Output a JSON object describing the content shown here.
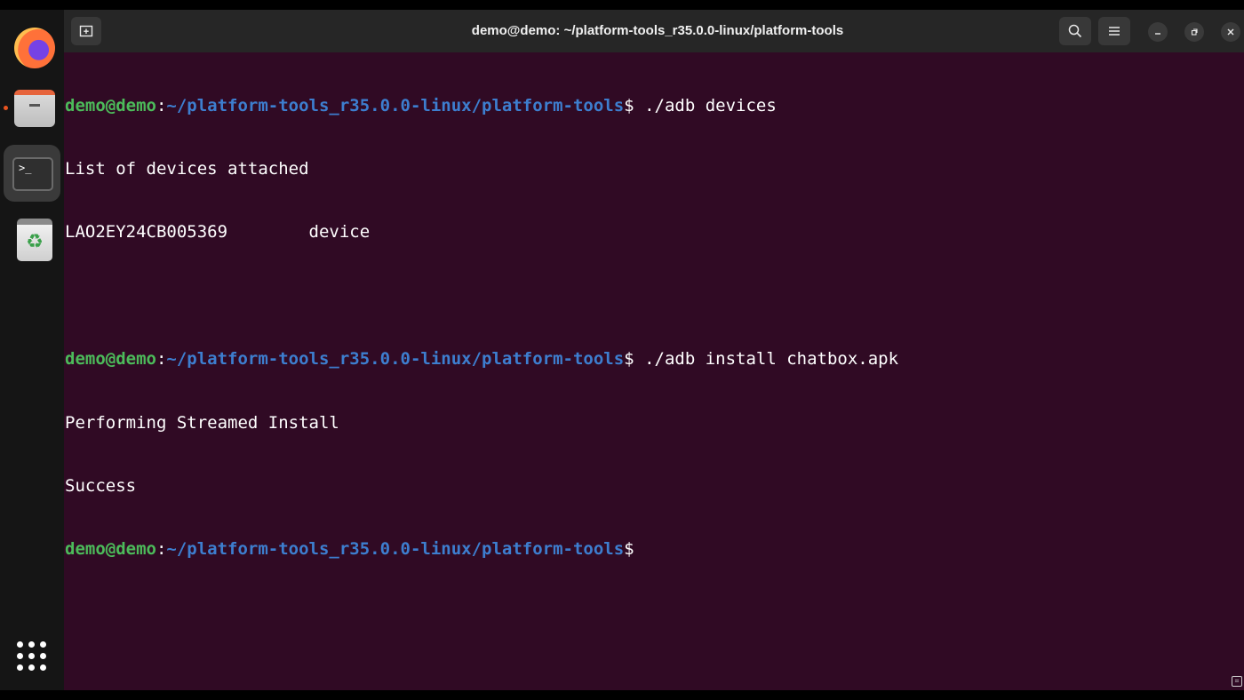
{
  "window": {
    "title": "demo@demo: ~/platform-tools_r35.0.0-linux/platform-tools",
    "new_tab_icon": "new-tab-icon",
    "controls": [
      "search-icon",
      "menu-icon",
      "minimize-icon",
      "restore-icon",
      "close-icon"
    ]
  },
  "dock": {
    "items": [
      "firefox-icon",
      "files-icon",
      "terminal-icon",
      "trash-icon"
    ],
    "show_apps_icon": "apps-grid-icon"
  },
  "terminal": {
    "user_host": "demo@demo",
    "path": "~/platform-tools_r35.0.0-linux/platform-tools",
    "prompt_symbol": "$",
    "lines": [
      {
        "type": "prompt",
        "command": " ./adb devices"
      },
      {
        "type": "output",
        "text": "List of devices attached"
      },
      {
        "type": "output",
        "text": "LAO2EY24CB005369\tdevice"
      },
      {
        "type": "output",
        "text": ""
      },
      {
        "type": "prompt",
        "command": " ./adb install chatbox.apk"
      },
      {
        "type": "output",
        "text": "Performing Streamed Install"
      },
      {
        "type": "output",
        "text": "Success"
      },
      {
        "type": "prompt",
        "command": ""
      }
    ]
  },
  "colors": {
    "terminal_bg": "#300a24",
    "user_host": "#4cbb5a",
    "path": "#3d7ecf",
    "titlebar": "#262626",
    "accent": "#e95420"
  }
}
